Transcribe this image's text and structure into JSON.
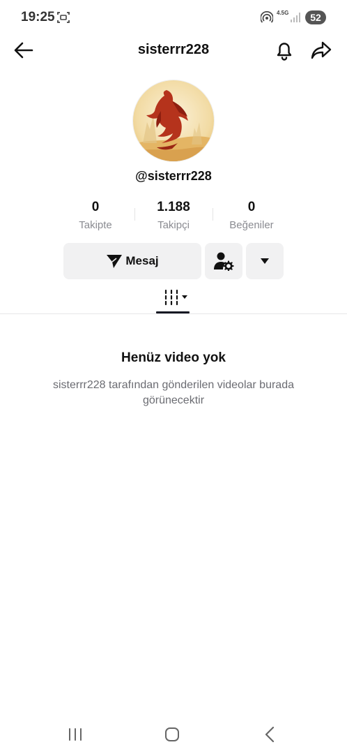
{
  "status_bar": {
    "time": "19:25",
    "network": "4.5G",
    "battery": "52",
    "icons": [
      "screen-recorder-icon",
      "hotspot-icon",
      "signal-icon"
    ]
  },
  "header": {
    "title": "sisterrr228",
    "icons": [
      "back-arrow-icon",
      "bell-icon",
      "share-icon"
    ]
  },
  "profile": {
    "handle": "@sisterrr228",
    "stats": [
      {
        "value": "0",
        "label": "Takipte"
      },
      {
        "value": "1.188",
        "label": "Takipçi"
      },
      {
        "value": "0",
        "label": "Beğeniler"
      }
    ]
  },
  "actions": {
    "message_label": "Mesaj",
    "icons": [
      "send-icon",
      "user-settings-icon",
      "caret-down-icon"
    ]
  },
  "tabs": {
    "active": "videos",
    "icons": [
      "grid-filter-icon"
    ]
  },
  "empty_state": {
    "title": "Henüz video yok",
    "description": "sisterrr228 tarafından gönderilen videolar burada görünecektir"
  },
  "navigation": {
    "icons": [
      "recent-apps-icon",
      "home-icon",
      "back-icon"
    ]
  },
  "colors": {
    "text": "#161823",
    "muted": "#8a8b91",
    "button_bg": "#f1f1f2"
  }
}
